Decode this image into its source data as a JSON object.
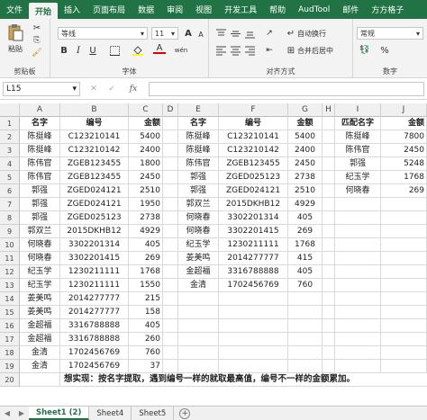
{
  "tabs": [
    "文件",
    "开始",
    "插入",
    "页面布局",
    "数据",
    "审阅",
    "视图",
    "开发工具",
    "帮助",
    "AudTool",
    "邮件",
    "方方格子"
  ],
  "active_tab": 1,
  "ribbon": {
    "paste_label": "粘贴",
    "clipboard_label": "剪贴板",
    "font_name": "等线",
    "font_size": "11",
    "font_label": "字体",
    "wrap_label": "自动换行",
    "merge_label": "合并后居中",
    "align_label": "对齐方式",
    "number_format": "常规",
    "number_label": "数字",
    "bold": "B",
    "italic": "I",
    "underline": "U",
    "font_grow": "A",
    "font_shrink": "A",
    "font_color": "A",
    "wen": "wén",
    "percent": "%"
  },
  "formula_bar": {
    "name_box": "L15",
    "fx": "fx"
  },
  "columns": [
    "A",
    "B",
    "C",
    "D",
    "E",
    "F",
    "G",
    "H",
    "I",
    "J"
  ],
  "rows": [
    [
      "名字",
      "编号",
      "金额",
      "",
      "名字",
      "编号",
      "金额",
      "",
      "匹配名字",
      "金额"
    ],
    [
      "陈挺峰",
      "C123210141",
      "5400",
      "",
      "陈挺峰",
      "C123210141",
      "5400",
      "",
      "陈挺峰",
      "7800"
    ],
    [
      "陈挺峰",
      "C123210142",
      "2400",
      "",
      "陈挺峰",
      "C123210142",
      "2400",
      "",
      "陈伟官",
      "2450"
    ],
    [
      "陈伟官",
      "ZGEB123455",
      "1800",
      "",
      "陈伟官",
      "ZGEB123455",
      "2450",
      "",
      "郭强",
      "5248"
    ],
    [
      "陈伟官",
      "ZGEB123455",
      "2450",
      "",
      "郭强",
      "ZGED025123",
      "2738",
      "",
      "纪玉学",
      "1768"
    ],
    [
      "郭强",
      "ZGED024121",
      "2510",
      "",
      "郭强",
      "ZGED024121",
      "2510",
      "",
      "何晓春",
      "269"
    ],
    [
      "郭强",
      "ZGED024121",
      "1950",
      "",
      "郭双兰",
      "2015DKHB12",
      "4929",
      "",
      "",
      ""
    ],
    [
      "郭强",
      "ZGED025123",
      "2738",
      "",
      "何晓春",
      "3302201314",
      "405",
      "",
      "",
      ""
    ],
    [
      "郭双兰",
      "2015DKHB12",
      "4929",
      "",
      "何晓春",
      "3302201415",
      "269",
      "",
      "",
      ""
    ],
    [
      "何晓春",
      "3302201314",
      "405",
      "",
      "纪玉学",
      "1230211111",
      "1768",
      "",
      "",
      ""
    ],
    [
      "何晓春",
      "3302201415",
      "269",
      "",
      "姜美鸣",
      "2014277777",
      "415",
      "",
      "",
      ""
    ],
    [
      "纪玉学",
      "1230211111",
      "1768",
      "",
      "金超福",
      "3316788888",
      "405",
      "",
      "",
      ""
    ],
    [
      "纪玉学",
      "1230211111",
      "1550",
      "",
      "金清",
      "1702456769",
      "760",
      "",
      "",
      ""
    ],
    [
      "姜美鸣",
      "2014277777",
      "215",
      "",
      "",
      "",
      "",
      "",
      "",
      ""
    ],
    [
      "姜美鸣",
      "2014277777",
      "158",
      "",
      "",
      "",
      "",
      "",
      "",
      ""
    ],
    [
      "金超福",
      "3316788888",
      "405",
      "",
      "",
      "",
      "",
      "",
      "",
      ""
    ],
    [
      "金超福",
      "3316788888",
      "260",
      "",
      "",
      "",
      "",
      "",
      "",
      ""
    ],
    [
      "金清",
      "1702456769",
      "760",
      "",
      "",
      "",
      "",
      "",
      "",
      ""
    ],
    [
      "金清",
      "1702456769",
      "37",
      "",
      "",
      "",
      "",
      "",
      "",
      ""
    ]
  ],
  "note": "想实现：按名字提取，遇到编号一样的就取最高值，编号不一样的金额累加。",
  "sheets": [
    "Sheet1 (2)",
    "Sheet4",
    "Sheet5"
  ],
  "active_sheet": 0
}
